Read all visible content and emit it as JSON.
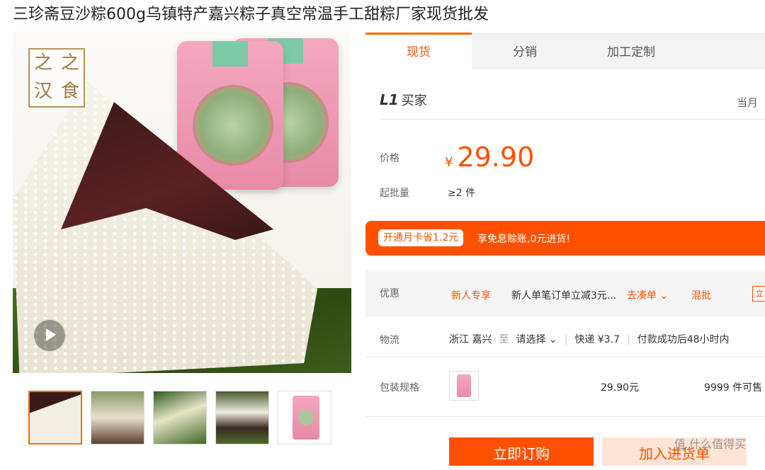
{
  "product": {
    "title": "三珍斋豆沙粽600g乌镇特产嘉兴粽子真空常温手工甜粽厂家现货批发"
  },
  "gallery": {
    "logo_chars": [
      "之",
      "之",
      "汉",
      "食"
    ],
    "thumbnail_count": 5,
    "selected_thumbnail": 1
  },
  "tabs": [
    "现货",
    "分销",
    "加工定制"
  ],
  "buyer": {
    "level": "L1",
    "label": "买家",
    "right_text": "当月"
  },
  "price": {
    "label": "价格",
    "currency": "¥",
    "value": "29.90"
  },
  "moq": {
    "label": "起批量",
    "value": "≥2 件"
  },
  "banner": {
    "pill": "开通月卡省1.2元",
    "text": "享免息赊账,0元进货!"
  },
  "promo": {
    "label": "优惠",
    "tag": "新人专享",
    "desc": "新人单笔订单立减3元...",
    "link": "去凑单 ⌄",
    "mix": "混批",
    "partial": "立"
  },
  "shipping": {
    "label": "物流",
    "from": "浙江 嘉兴",
    "to_word": "至",
    "dest": "请选择 ⌄",
    "express": "快递 ¥3.7",
    "eta": "付款成功后48小时内"
  },
  "packaging": {
    "label": "包装规格",
    "price": "29.90元",
    "stock": "9999 件可售"
  },
  "actions": {
    "buy": "立即订购",
    "cart": "加入进货单"
  },
  "watermark": "值 什么值得买",
  "colors": {
    "accent": "#ff5000",
    "tab_active": "#ff6a00"
  }
}
